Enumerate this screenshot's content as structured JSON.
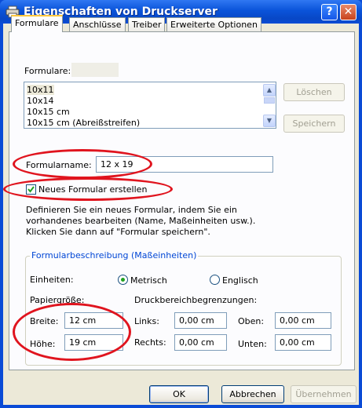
{
  "window": {
    "title": "Eigenschaften von Druckserver",
    "help_glyph": "?",
    "close_glyph": "✕"
  },
  "tabs": [
    {
      "label": "Formulare",
      "active": true
    },
    {
      "label": "Anschlüsse",
      "active": false
    },
    {
      "label": "Treiber",
      "active": false
    },
    {
      "label": "Erweiterte Optionen",
      "active": false
    }
  ],
  "forms_list": {
    "label": "Formulare:",
    "items": [
      "10x11",
      "10x14",
      "10x15 cm",
      "10x15 cm (Abreißstreifen)"
    ],
    "selected_index": 0,
    "delete_label": "Löschen",
    "save_label": "Speichern"
  },
  "form_name": {
    "label": "Formularname:",
    "value": "12 x 19"
  },
  "new_form_checkbox": {
    "label": "Neues Formular erstellen",
    "checked": true
  },
  "description": {
    "line1": "Definieren Sie ein neues Formular, indem Sie ein",
    "line2": "vorhandenes bearbeiten (Name, Maßeinheiten usw.).",
    "line3": "Klicken Sie dann auf \"Formular speichern\"."
  },
  "group": {
    "legend": "Formularbeschreibung (Maßeinheiten)",
    "units_label": "Einheiten:",
    "metric_label": "Metrisch",
    "english_label": "Englisch",
    "selected_unit": "Metrisch",
    "paper_size_label": "Papiergröße:",
    "print_area_label": "Druckbereichbegrenzungen:",
    "width_label": "Breite:",
    "width_value": "12 cm",
    "height_label": "Höhe:",
    "height_value": "19 cm",
    "left_label": "Links:",
    "left_value": "0,00 cm",
    "top_label": "Oben:",
    "top_value": "0,00 cm",
    "right_label": "Rechts:",
    "right_value": "0,00 cm",
    "bottom_label": "Unten:",
    "bottom_value": "0,00 cm"
  },
  "footer": {
    "ok_label": "OK",
    "cancel_label": "Abbrechen",
    "apply_label": "Übernehmen"
  },
  "colors": {
    "highlight_ellipse": "#e0141e",
    "titlebar": "#0a53d9",
    "client": "#ece9d8",
    "group_legend": "#0046d5"
  }
}
